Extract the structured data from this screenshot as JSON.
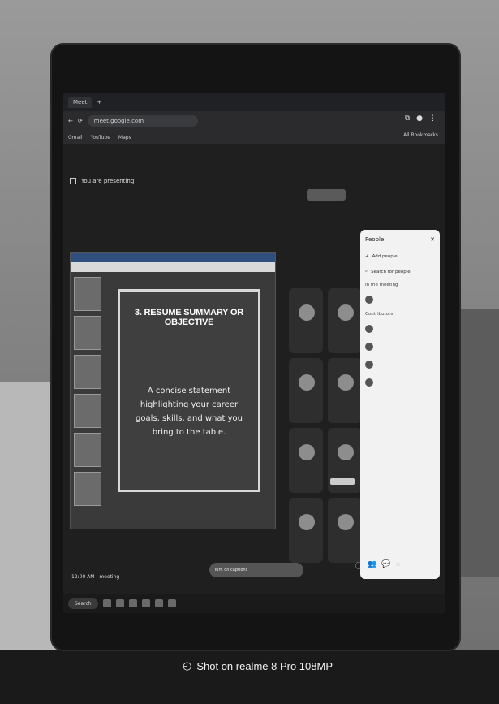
{
  "browser": {
    "tab_title": "Meet",
    "url": "meet.google.com",
    "bookmarks": [
      "Gmail",
      "YouTube",
      "Maps"
    ],
    "all_bookmarks_label": "All Bookmarks"
  },
  "meet": {
    "presenting_label": "You are presenting",
    "meeting_code": "12:00 AM | meeting",
    "caption_text": "Turn on captions"
  },
  "presentation": {
    "slide_title": "3. RESUME SUMMARY OR OBJECTIVE",
    "slide_body": "A concise statement highlighting your career goals, skills, and what you bring to the table."
  },
  "people_panel": {
    "title": "People",
    "add_people": "Add people",
    "search_placeholder": "Search for people",
    "section_label": "In the meeting",
    "contributors_label": "Contributors"
  },
  "taskbar": {
    "search_label": "Search"
  },
  "watermark": {
    "text": "Shot on realme 8 Pro 108MP"
  }
}
